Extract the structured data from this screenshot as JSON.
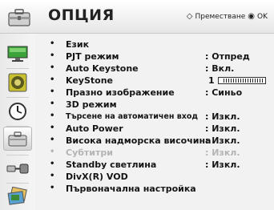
{
  "header": {
    "title": "ОПЦИЯ",
    "hint_nav_glyph": "◇",
    "hint_nav": "Преместване",
    "hint_ok_glyph": "◉",
    "hint_ok": "OK"
  },
  "rail": {
    "items": [
      {
        "name": "picture",
        "icon": "tv-screen-icon"
      },
      {
        "name": "audio",
        "icon": "speaker-icon"
      },
      {
        "name": "time",
        "icon": "clock-icon"
      },
      {
        "name": "option",
        "icon": "toolbox-icon",
        "active": true
      },
      {
        "name": "input",
        "icon": "connector-cable-icon"
      },
      {
        "name": "my-media",
        "icon": "photo-stack-icon"
      }
    ]
  },
  "menu": {
    "items": [
      {
        "label": "Език",
        "value": ""
      },
      {
        "label": "PJT режим",
        "value": ": Отпред"
      },
      {
        "label": "Auto Keystone",
        "value": ": Вкл."
      },
      {
        "label": "KeyStone",
        "value": "1",
        "bar_level": 1
      },
      {
        "label": "Празно изображение",
        "value": ": Синьо"
      },
      {
        "label": "3D режим",
        "value": ""
      },
      {
        "label": "Търсене на автоматичен вход",
        "value": ": Изкл."
      },
      {
        "label": "Auto Power",
        "value": ": Изкл."
      },
      {
        "label": "Висока надморска височина",
        "value": ": Изкл."
      },
      {
        "label": "Субтитри",
        "value": ": Изкл.",
        "disabled": true
      },
      {
        "label": "Standby светлина",
        "value": ": Изкл."
      },
      {
        "label": "DivX(R) VOD",
        "value": ""
      },
      {
        "label": "Първоначална настройка",
        "value": ""
      }
    ],
    "bullet": "•"
  },
  "colors": {
    "header_bg": "#f7f7f7",
    "panel_bg": "#f2f2f2",
    "text": "#151515",
    "disabled": "#b4b4b4"
  }
}
